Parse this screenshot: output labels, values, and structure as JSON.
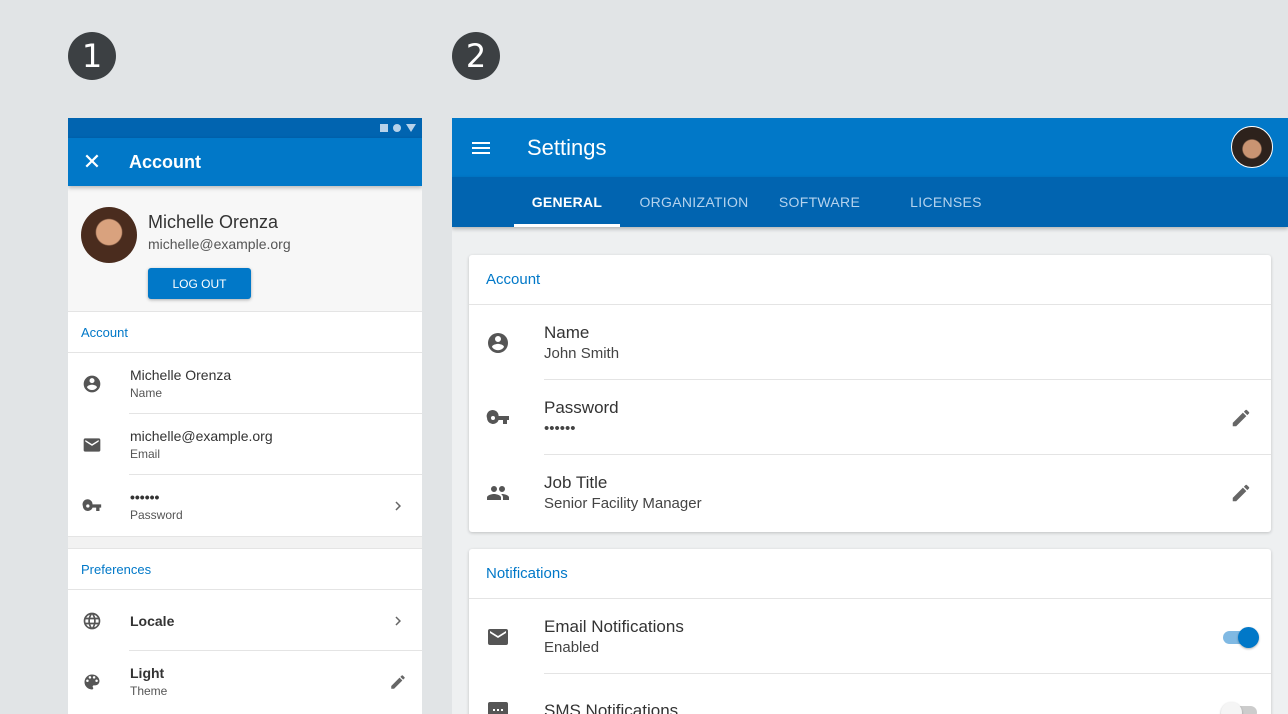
{
  "badges": [
    "1",
    "2"
  ],
  "mobile": {
    "title": "Account",
    "close_icon": "close-icon",
    "profile": {
      "name": "Michelle Orenza",
      "email": "michelle@example.org",
      "logout_label": "LOG OUT"
    },
    "account_section": "Account",
    "account_rows": [
      {
        "primary": "Michelle Orenza",
        "secondary": "Name",
        "icon": "account-circle-icon"
      },
      {
        "primary": "michelle@example.org",
        "secondary": "Email",
        "icon": "mail-icon"
      },
      {
        "primary": "••••••",
        "secondary": "Password",
        "icon": "key-icon",
        "trailing": "chevron-right-icon"
      }
    ],
    "preferences_section": "Preferences",
    "preference_rows": [
      {
        "primary": "Locale",
        "icon": "globe-icon",
        "trailing": "chevron-right-icon"
      },
      {
        "primary": "Light",
        "secondary": "Theme",
        "icon": "palette-icon",
        "trailing": "edit-icon"
      }
    ]
  },
  "desktop": {
    "title": "Settings",
    "tabs": [
      {
        "label": "GENERAL",
        "active": true
      },
      {
        "label": "ORGANIZATION",
        "active": false
      },
      {
        "label": "SOFTWARE",
        "active": false
      },
      {
        "label": "LICENSES",
        "active": false
      }
    ],
    "account_card": {
      "heading": "Account",
      "rows": [
        {
          "primary": "Name",
          "secondary": "John Smith",
          "icon": "account-circle-icon"
        },
        {
          "primary": "Password",
          "secondary": "••••••",
          "icon": "key-icon",
          "trailing": "edit-icon"
        },
        {
          "primary": "Job Title",
          "secondary": "Senior Facility Manager",
          "icon": "people-icon",
          "trailing": "edit-icon"
        }
      ]
    },
    "notifications_card": {
      "heading": "Notifications",
      "rows": [
        {
          "primary": "Email Notifications",
          "secondary": "Enabled",
          "icon": "mail-icon",
          "toggle_on": true
        },
        {
          "primary": "SMS Notifications",
          "secondary": "",
          "icon": "sms-icon",
          "toggle_on": false
        }
      ]
    }
  }
}
